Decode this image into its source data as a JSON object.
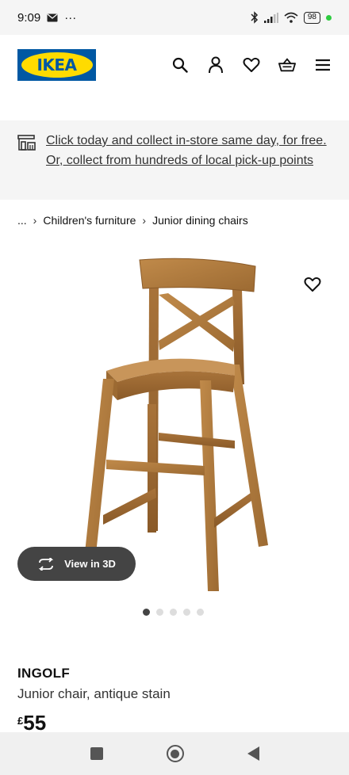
{
  "status_bar": {
    "time": "9:09",
    "dots": "···",
    "battery": "98"
  },
  "logo": {
    "text": "IKEA"
  },
  "notice": {
    "text": "Click today and collect in-store same day, for free. Or, collect from hundreds of local pick-up points"
  },
  "breadcrumb": {
    "ellipsis": "...",
    "items": [
      "Children's furniture",
      "Junior dining chairs"
    ]
  },
  "product": {
    "name": "INGOLF",
    "description": "Junior chair, antique stain",
    "currency": "£",
    "price": "55",
    "view_3d_label": "View in 3D",
    "image_count": 5,
    "active_image": 0
  }
}
